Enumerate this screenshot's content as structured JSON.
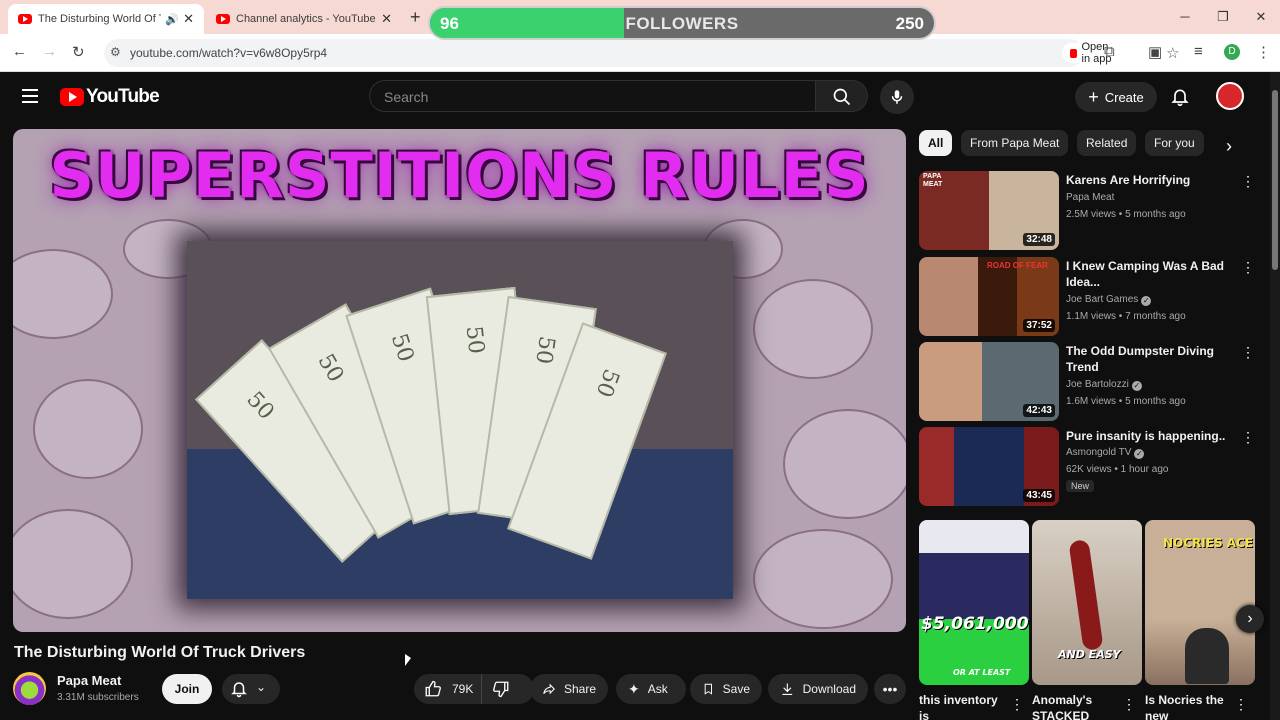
{
  "browser": {
    "tabs": [
      {
        "title": "The Disturbing World Of Truck",
        "active": true
      },
      {
        "title": "Channel analytics - YouTube Stu",
        "active": false
      }
    ],
    "url": "youtube.com/watch?v=v6w8Opy5rp4",
    "open_in_app": "Open in app",
    "profile_initial": "D"
  },
  "followers_widget": {
    "current": "96",
    "label": "FOLLOWERS",
    "goal": "250",
    "progress_fraction": 0.384
  },
  "header": {
    "logo_text": "YouTube",
    "search_placeholder": "Search",
    "create_label": "Create"
  },
  "video": {
    "thumbnail_title": "SUPERSTITIONS RULES",
    "bill_denomination": "50",
    "title": "The Disturbing World Of Truck Drivers",
    "channel": "Papa Meat",
    "subscribers": "3.31M subscribers",
    "join_label": "Join",
    "likes": "79K",
    "share_label": "Share",
    "ask_label": "Ask",
    "save_label": "Save",
    "download_label": "Download"
  },
  "chips": [
    "All",
    "From Papa Meat",
    "Related",
    "For you"
  ],
  "recommendations": [
    {
      "title": "Karens Are Horrifying",
      "channel": "Papa Meat",
      "verified": false,
      "meta": "2.5M views • 5 months ago",
      "duration": "32:48",
      "badge": "",
      "thumb_label": "PAPA MEAT"
    },
    {
      "title": "I Knew Camping Was A Bad Idea...",
      "channel": "Joe Bart Games",
      "verified": true,
      "meta": "1.1M views • 7 months ago",
      "duration": "37:52",
      "badge": "",
      "thumb_label": "ROAD OF FEAR"
    },
    {
      "title": "The Odd Dumpster Diving Trend",
      "channel": "Joe Bartolozzi",
      "verified": true,
      "meta": "1.6M views • 5 months ago",
      "duration": "42:43",
      "badge": "",
      "thumb_label": ""
    },
    {
      "title": "Pure insanity is happening..",
      "channel": "Asmongold TV",
      "verified": true,
      "meta": "62K views • 1 hour ago",
      "duration": "43:45",
      "badge": "New",
      "thumb_label": ""
    }
  ],
  "shorts": [
    {
      "title": "this inventory is",
      "overlay": "$5,061,000",
      "overlay2": "OR AT LEAST"
    },
    {
      "title": "Anomaly's STACKED",
      "overlay": "AND EASY",
      "overlay2": ""
    },
    {
      "title": "Is Nocries the new",
      "overlay": "NOCRIES ACE",
      "overlay2": ""
    }
  ],
  "colors": {
    "yt_red": "#ff0000",
    "bg": "#0f0f0f",
    "progress_green": "#3bd16f",
    "thumb_title_magenta": "#e22cf0"
  }
}
